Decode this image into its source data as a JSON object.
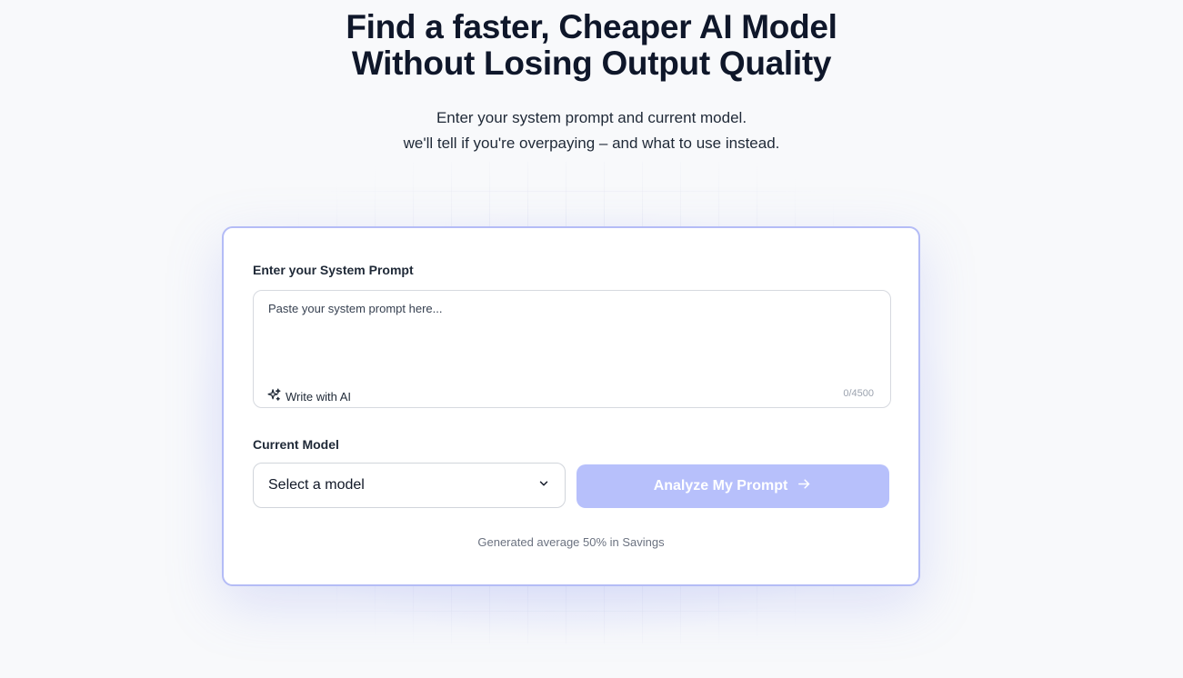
{
  "hero": {
    "title_line1": "Find a faster, Cheaper AI Model",
    "title_line2": "Without Losing Output Quality",
    "subtitle_line1": "Enter your system prompt and current model.",
    "subtitle_line2": "we'll tell if you're overpaying – and what to use instead."
  },
  "form": {
    "prompt_label": "Enter your System Prompt",
    "prompt_placeholder": "Paste your system prompt here...",
    "prompt_value": "",
    "write_ai_label": "Write with AI",
    "write_ai_icon": "sparkle-icon",
    "char_count": "0/4500",
    "model_label": "Current Model",
    "model_selected": "Select a model",
    "model_icon": "chevron-down-icon",
    "analyze_label": "Analyze My Prompt",
    "analyze_icon": "arrow-right-icon",
    "savings_text": "Generated average 50% in Savings"
  },
  "colors": {
    "accent_border": "#b4bcf6",
    "button_disabled": "#b7c0fb",
    "title": "#0f172a",
    "background": "#f8f9fb"
  }
}
